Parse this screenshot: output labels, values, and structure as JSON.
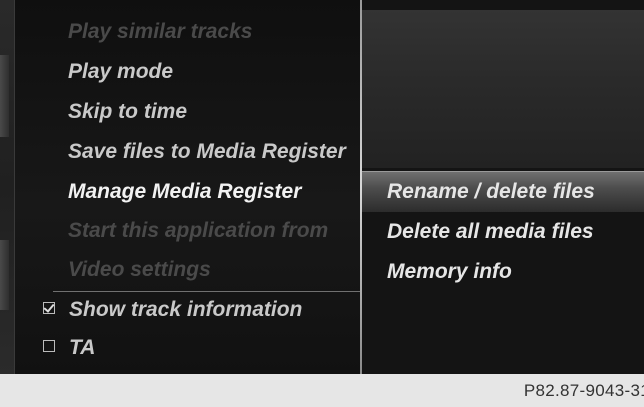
{
  "main_menu": {
    "items": [
      {
        "label": "Play similar tracks",
        "state": "disabled"
      },
      {
        "label": "Play mode",
        "state": "enabled"
      },
      {
        "label": "Skip to time",
        "state": "enabled"
      },
      {
        "label": "Save files to Media Register",
        "state": "enabled"
      },
      {
        "label": "Manage Media Register",
        "state": "selected"
      },
      {
        "label": "Start this application from",
        "state": "disabled"
      },
      {
        "label": "Video settings",
        "state": "disabled"
      }
    ],
    "toggles": [
      {
        "label": "Show track information",
        "checked": true
      },
      {
        "label": "TA",
        "checked": false
      }
    ]
  },
  "submenu": {
    "items": [
      {
        "label": "Rename / delete files",
        "highlighted": true
      },
      {
        "label": "Delete all media files",
        "highlighted": false
      },
      {
        "label": "Memory info",
        "highlighted": false
      }
    ]
  },
  "caption": "P82.87-9043-31",
  "colors": {
    "background": "#151515",
    "text_enabled": "#c9c9c9",
    "text_disabled": "#4a4a4a",
    "text_selected": "#f2f2f2",
    "highlight": "#5a5a5a",
    "caption_bar": "#e6e6e6"
  }
}
